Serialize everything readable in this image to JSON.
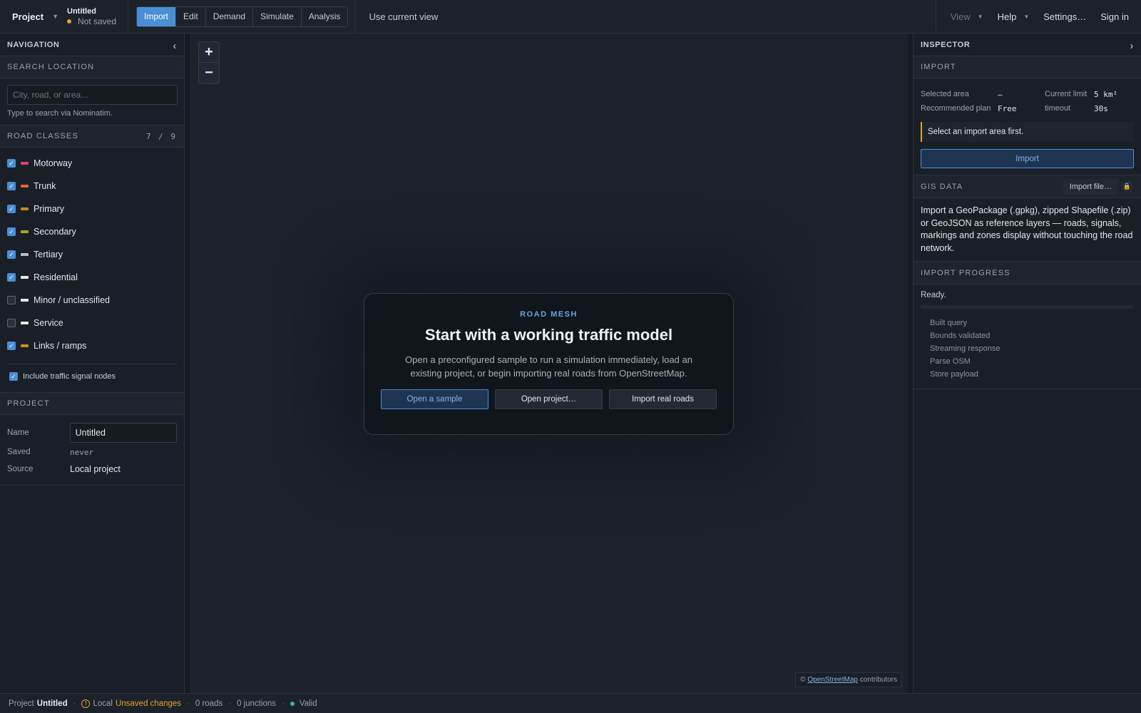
{
  "topbar": {
    "project_label": "Project",
    "project_title": "Untitled",
    "project_status": "Not saved",
    "tabs": [
      {
        "label": "Import",
        "active": true
      },
      {
        "label": "Edit",
        "active": false
      },
      {
        "label": "Demand",
        "active": false
      },
      {
        "label": "Simulate",
        "active": false
      },
      {
        "label": "Analysis",
        "active": false
      }
    ],
    "use_current_view": "Use current view",
    "view_label": "View",
    "help_label": "Help",
    "settings_label": "Settings…",
    "signin_label": "Sign in"
  },
  "navigation": {
    "title": "NAVIGATION",
    "search_section": "SEARCH LOCATION",
    "search_placeholder": "City, road, or area…",
    "search_value": "",
    "search_hint": "Type to search via Nominatim.",
    "road_classes_title": "ROAD CLASSES",
    "road_classes_count": "7 / 9",
    "road_classes": [
      {
        "label": "Motorway",
        "checked": true,
        "color": "#d9457a"
      },
      {
        "label": "Trunk",
        "checked": true,
        "color": "#e0643a"
      },
      {
        "label": "Primary",
        "checked": true,
        "color": "#c48a1e"
      },
      {
        "label": "Secondary",
        "checked": true,
        "color": "#a3a82a"
      },
      {
        "label": "Tertiary",
        "checked": true,
        "color": "#b9bec6"
      },
      {
        "label": "Residential",
        "checked": true,
        "color": "#e4e7eb"
      },
      {
        "label": "Minor / unclassified",
        "checked": false,
        "color": "#e4e7eb"
      },
      {
        "label": "Service",
        "checked": false,
        "color": "#e4e7eb"
      },
      {
        "label": "Links / ramps",
        "checked": true,
        "color": "#d48a1e"
      }
    ],
    "signal_nodes_label": "Include traffic signal nodes",
    "signal_nodes_checked": true,
    "project_section": "PROJECT",
    "project_fields": {
      "name_label": "Name",
      "name_value": "Untitled",
      "saved_label": "Saved",
      "saved_value": "never",
      "source_label": "Source",
      "source_value": "Local project"
    }
  },
  "map": {
    "zoom_in": "+",
    "zoom_out": "−",
    "attribution_prefix": "©",
    "attribution_link": "OpenStreetMap",
    "attribution_suffix": "contributors"
  },
  "modal": {
    "kicker": "ROAD MESH",
    "title": "Start with a working traffic model",
    "description": "Open a preconfigured sample to run a simulation immediately, load an existing project, or begin importing real roads from OpenStreetMap.",
    "btn_sample": "Open a sample",
    "btn_open": "Open project…",
    "btn_import": "Import real roads"
  },
  "inspector": {
    "title": "INSPECTOR",
    "import_section": "IMPORT",
    "selected_area_label": "Selected area",
    "selected_area_value": "—",
    "current_limit_label": "Current limit",
    "current_limit_value": "5 km²",
    "recommended_plan_label": "Recommended plan",
    "recommended_plan_value": "Free",
    "timeout_label": "timeout",
    "timeout_value": "30s",
    "notice": "Select an import area first.",
    "import_button": "Import",
    "gis_section": "GIS DATA",
    "import_file_button": "Import file…",
    "gis_description": "Import a GeoPackage (.gpkg), zipped Shapefile (.zip) or GeoJSON as reference layers — roads, signals, markings and zones display without touching the road network.",
    "progress_section": "IMPORT PROGRESS",
    "progress_status": "Ready.",
    "progress_fraction": 0,
    "steps": [
      "Built query",
      "Bounds validated",
      "Streaming response",
      "Parse OSM",
      "Store payload"
    ]
  },
  "statusbar": {
    "project_label": "Project",
    "project_name": "Untitled",
    "local_label": "Local",
    "unsaved_label": "Unsaved changes",
    "roads": "0 roads",
    "junctions": "0 junctions",
    "valid": "Valid"
  },
  "colors": {
    "accent": "#4a8fd6",
    "warning": "#e0a526",
    "valid": "#3fb98a",
    "background": "#1b2029"
  },
  "icons": [
    "chevron-down-icon",
    "chevron-left-icon",
    "chevron-right-icon",
    "lock-icon",
    "warning-icon",
    "status-dot-icon",
    "check-icon"
  ]
}
